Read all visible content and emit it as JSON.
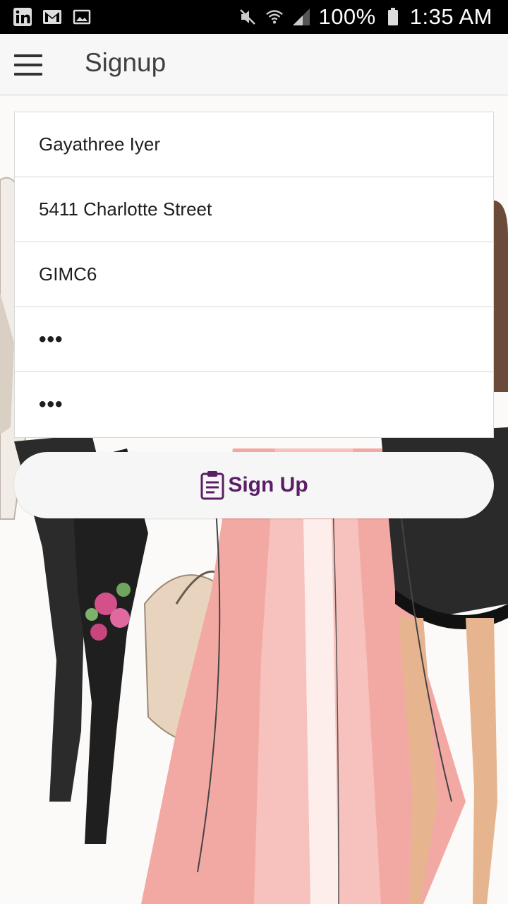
{
  "status_bar": {
    "left_icons": [
      "linkedin-icon",
      "gmail-icon",
      "image-icon"
    ],
    "battery": "100%",
    "time": "1:35 AM"
  },
  "app_bar": {
    "title": "Signup",
    "menu_icon": "hamburger-icon"
  },
  "form": {
    "fields": [
      {
        "name": "name",
        "value": "Gayathree Iyer"
      },
      {
        "name": "address",
        "value": "5411 Charlotte Street"
      },
      {
        "name": "code",
        "value": "GIMC6"
      },
      {
        "name": "password",
        "value": "•••"
      },
      {
        "name": "confirm_password",
        "value": "•••"
      }
    ],
    "submit": {
      "label": "Sign Up",
      "icon": "clipboard-icon"
    }
  },
  "colors": {
    "accent": "#5a1e66",
    "appbar_bg": "#f7f7f7",
    "status_bar_bg": "#000000"
  }
}
